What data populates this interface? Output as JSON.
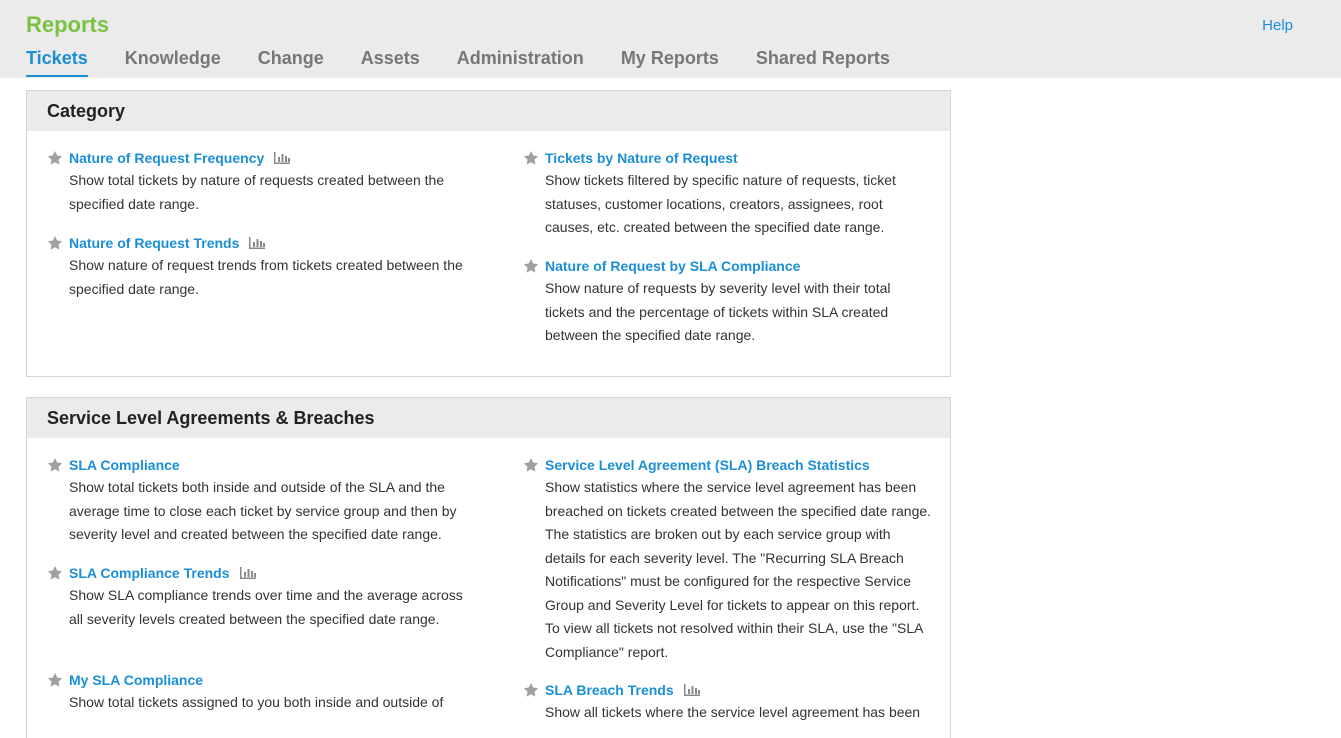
{
  "header": {
    "app_title": "Reports",
    "help_label": "Help",
    "tabs": [
      {
        "label": "Tickets"
      },
      {
        "label": "Knowledge"
      },
      {
        "label": "Change"
      },
      {
        "label": "Assets"
      },
      {
        "label": "Administration"
      },
      {
        "label": "My Reports"
      },
      {
        "label": "Shared Reports"
      }
    ]
  },
  "colors": {
    "accent": "#1a8fd6",
    "brand": "#7bc142",
    "star": "#a0a0a0"
  },
  "sections": [
    {
      "title": "Category",
      "reports": [
        {
          "title": "Nature of Request Frequency",
          "chart_icon": "bar-chart-icon",
          "description": "Show total tickets by nature of requests created between the specified date range."
        },
        {
          "title": "Nature of Request Trends",
          "chart_icon": "bar-chart-icon",
          "description": "Show nature of request trends from tickets created between the specified date range."
        },
        {
          "title": "Tickets by Nature of Request",
          "description": "Show tickets filtered by specific nature of requests, ticket statuses, customer locations, creators, assignees, root causes, etc. created between the specified date range."
        },
        {
          "title": "Nature of Request by SLA Compliance",
          "description": "Show nature of requests by severity level with their total tickets and the percentage of tickets within SLA created between the specified date range."
        }
      ]
    },
    {
      "title": "Service Level Agreements & Breaches",
      "reports": [
        {
          "title": "SLA Compliance",
          "description": "Show total tickets both inside and outside of the SLA and the average time to close each ticket by service group and then by severity level and created between the specified date range."
        },
        {
          "title": "SLA Compliance Trends",
          "chart_icon": "bar-chart-icon",
          "description": "Show SLA compliance trends over time and the average across all severity levels created between the specified date range."
        },
        {
          "title": "My SLA Compliance",
          "description": "Show total tickets assigned to you both inside and outside of"
        },
        {
          "title": "Service Level Agreement (SLA) Breach Statistics",
          "description": "Show statistics where the service level agreement has been breached on tickets created between the specified date range. The statistics are broken out by each service group with details for each severity level. The \"Recurring SLA Breach Notifications\" must be configured for the respective Service Group and Severity Level for tickets to appear on this report. To view all tickets not resolved within their SLA, use the \"SLA Compliance\" report."
        },
        {
          "title": "SLA Breach Trends",
          "chart_icon": "bar-chart-icon",
          "description": "Show all tickets where the service level agreement has been"
        }
      ]
    }
  ]
}
